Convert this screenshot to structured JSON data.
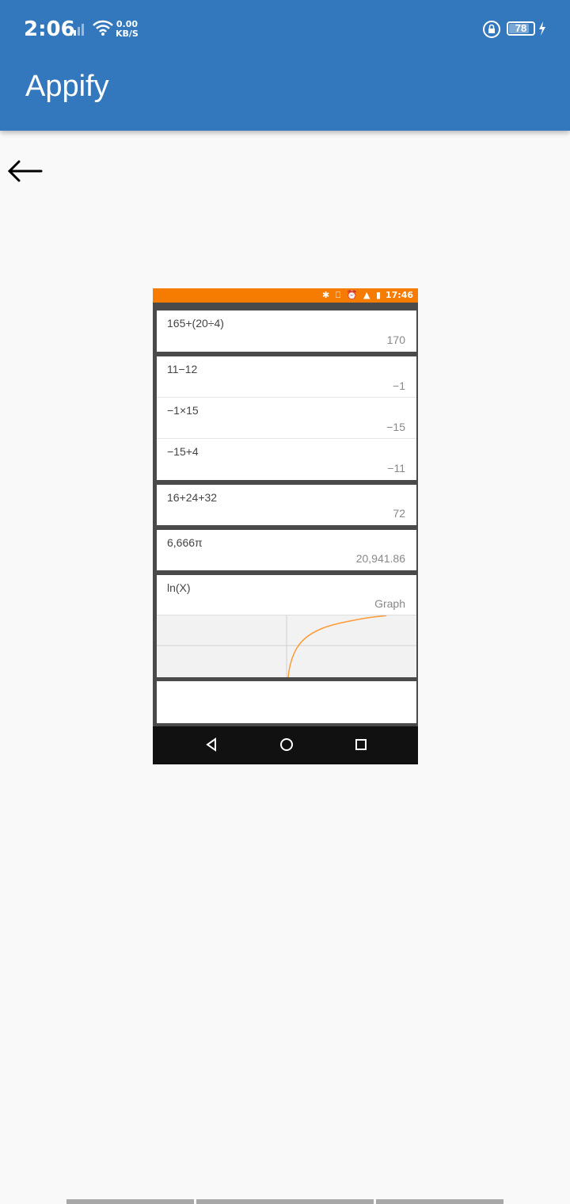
{
  "status_bar": {
    "time": "2:06",
    "net_speed_value": "0.00",
    "net_speed_unit": "KB/S",
    "battery_level": "78",
    "icons": [
      "signal-icon",
      "wifi-icon",
      "rotation-lock-icon",
      "battery-icon",
      "charging-bolt-icon"
    ]
  },
  "app_bar": {
    "title": "Appify",
    "color": "#3377bd"
  },
  "back_icon": "arrow-left-icon",
  "preview": {
    "status_time": "17:46",
    "status_color": "#f57c00",
    "calculations": [
      {
        "expression": "165+(20÷4)",
        "result": "170"
      },
      {
        "expression": "11−12",
        "result": "−1"
      },
      {
        "expression": "−1×15",
        "result": "−15"
      },
      {
        "expression": "−15+4",
        "result": "−11"
      },
      {
        "expression": "16+24+32",
        "result": "72"
      },
      {
        "expression": "6,666π",
        "result": "20,941.86"
      },
      {
        "expression": "ln(X)",
        "result": "Graph"
      }
    ],
    "graph_curve_color": "#ff9933"
  }
}
